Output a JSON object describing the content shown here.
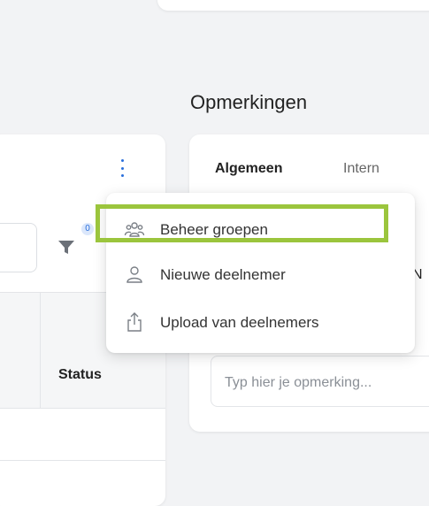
{
  "remarks": {
    "title": "Opmerkingen",
    "tabs": [
      {
        "label": "Algemeen",
        "active": true
      },
      {
        "label": "Intern",
        "active": false
      }
    ],
    "partial_text": "N",
    "input_placeholder": "Typ hier je opmerking..."
  },
  "participants": {
    "filter_badge": "0",
    "status_header": "Status"
  },
  "menu": {
    "items": [
      {
        "label": "Beheer groepen",
        "icon": "users-group-icon"
      },
      {
        "label": "Nieuwe deelnemer",
        "icon": "user-icon"
      },
      {
        "label": "Upload van deelnemers",
        "icon": "upload-icon"
      }
    ]
  },
  "colors": {
    "accent": "#2a6fdb",
    "highlight": "#9bc53d"
  }
}
